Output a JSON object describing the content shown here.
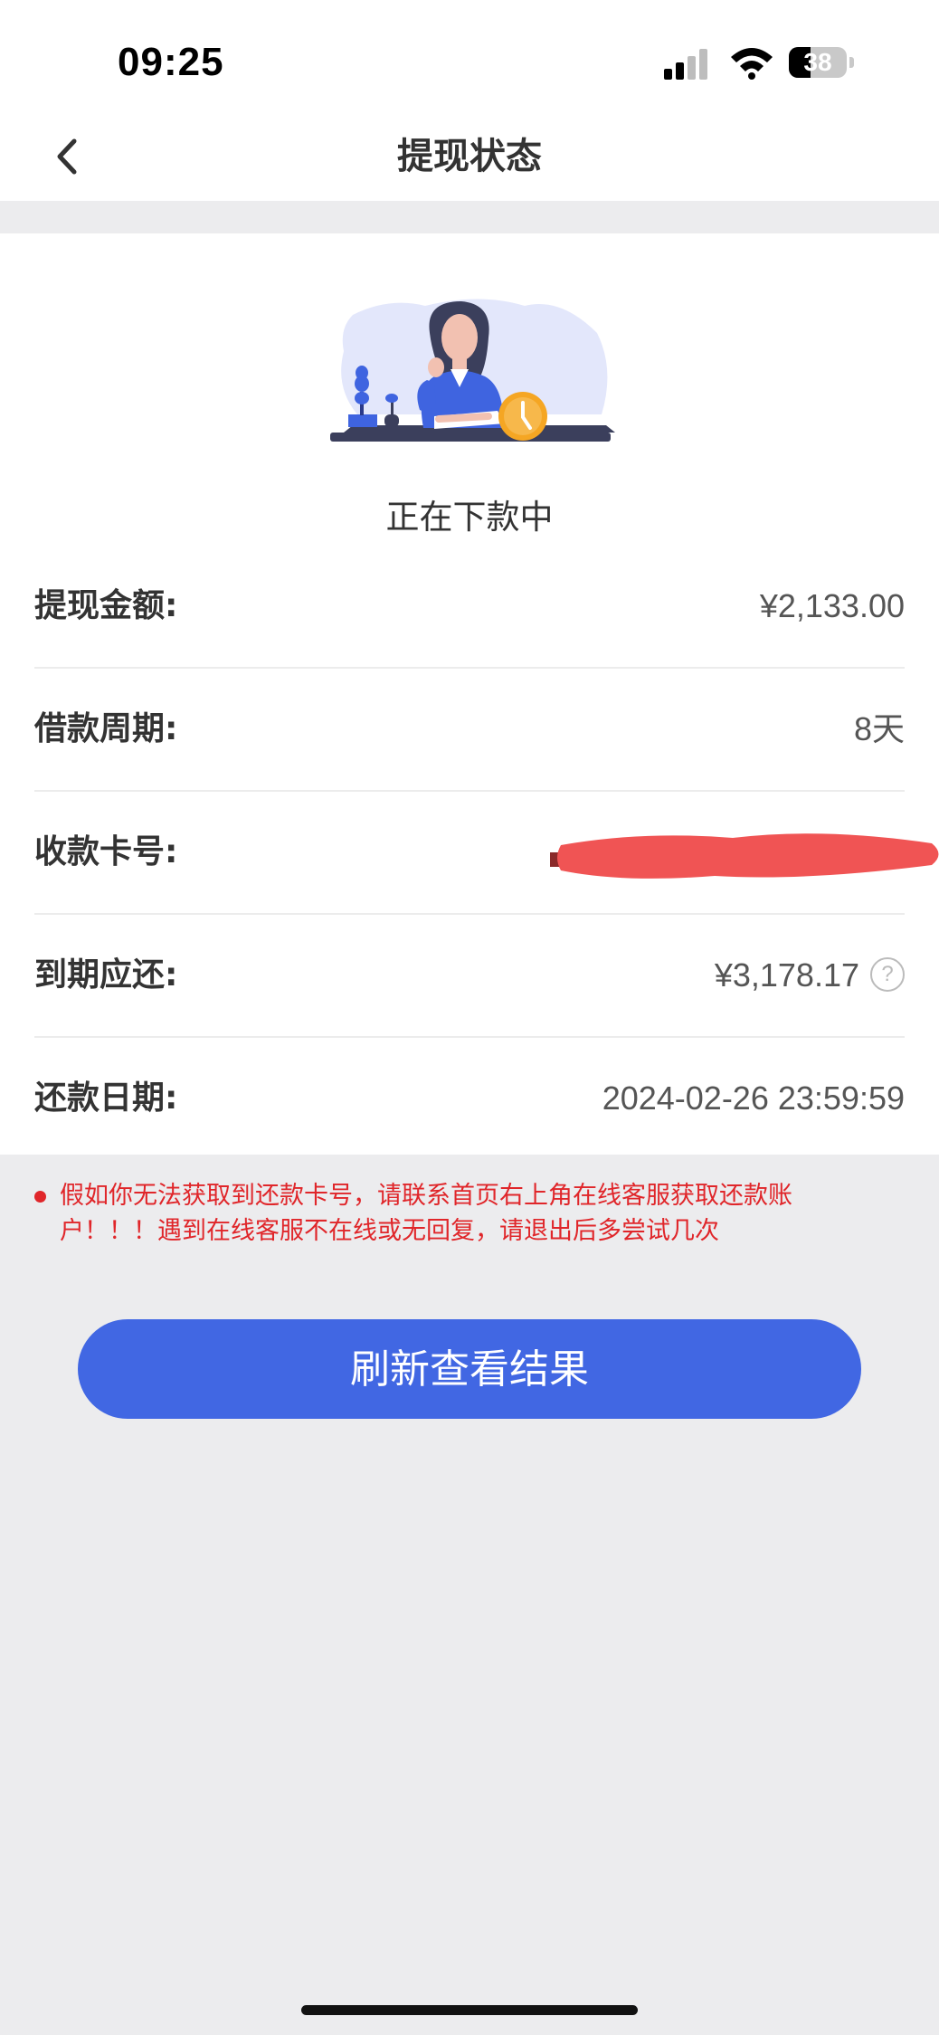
{
  "status_bar": {
    "time": "09:25",
    "battery_percent": 38,
    "battery_label": "38",
    "icons": [
      "signal-icon",
      "wifi-icon",
      "battery-icon"
    ]
  },
  "nav": {
    "back_icon": "chevron-left-icon",
    "title": "提现状态"
  },
  "status": {
    "illustration": "woman-at-desk-with-clock-illustration",
    "text": "正在下款中"
  },
  "details": {
    "withdraw_amount": {
      "label": "提现金额:",
      "value": "¥2,133.00"
    },
    "loan_period": {
      "label": "借款周期:",
      "value": "8天"
    },
    "card_number": {
      "label": "收款卡号:",
      "value": ""
    },
    "due_repayment": {
      "label": "到期应还:",
      "value": "¥3,178.17",
      "help_icon": "question-circle-icon",
      "help_symbol": "?"
    },
    "repay_date": {
      "label": "还款日期:",
      "value": "2024-02-26 23:59:59"
    }
  },
  "notice": {
    "text": "假如你无法获取到还款卡号，请联系首页右上角在线客服获取还款账户！！！遇到在线客服不在线或无回复，请退出后多尝试几次"
  },
  "refresh_button": {
    "label": "刷新查看结果"
  },
  "colors": {
    "accent": "#4167e3",
    "notice": "#e0262a",
    "background": "#ececee"
  }
}
